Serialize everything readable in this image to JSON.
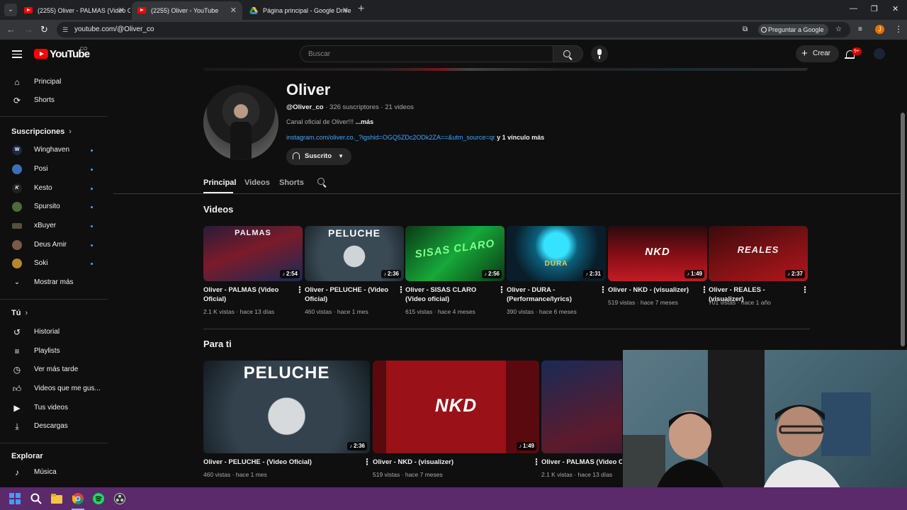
{
  "browser": {
    "tabs": [
      {
        "label": "(2255) Oliver - PALMAS (Video Ofi"
      },
      {
        "label": "(2255) Oliver - YouTube"
      },
      {
        "label": "Página principal - Google Drive"
      }
    ],
    "url": "youtube.com/@Oliver_co",
    "ask_google": "Preguntar a Google",
    "profile_initial": "J"
  },
  "header": {
    "logo_text": "YouTube",
    "country": "CO",
    "search_placeholder": "Buscar",
    "create_label": "Crear",
    "notif_count": "9+"
  },
  "sidebar": {
    "main": [
      {
        "label": "Principal",
        "icon": "home-icon"
      },
      {
        "label": "Shorts",
        "icon": "shorts-icon"
      }
    ],
    "subs_heading": "Suscripciones",
    "subs": [
      {
        "label": "Winghaven",
        "abbr": "W",
        "color": "#1e2a44"
      },
      {
        "label": "Posi",
        "abbr": "",
        "color": "#3d6fb6"
      },
      {
        "label": "Kesto",
        "abbr": "K",
        "color": "#222222"
      },
      {
        "label": "Spursito",
        "abbr": "",
        "color": "#4d6b3a"
      },
      {
        "label": "xBuyer",
        "abbr": "",
        "color": "#55503a"
      },
      {
        "label": "Deus Amir",
        "abbr": "",
        "color": "#7a5a48"
      },
      {
        "label": "Soki",
        "abbr": "",
        "color": "#b7862d"
      }
    ],
    "show_more": "Mostrar más",
    "you_heading": "Tú",
    "you": [
      {
        "label": "Historial",
        "icon": "history-icon"
      },
      {
        "label": "Playlists",
        "icon": "playlists-icon"
      },
      {
        "label": "Ver más tarde",
        "icon": "watch-later-icon"
      },
      {
        "label": "Videos que me gus...",
        "icon": "liked-videos-icon"
      },
      {
        "label": "Tus videos",
        "icon": "your-videos-icon"
      },
      {
        "label": "Descargas",
        "icon": "downloads-icon"
      }
    ],
    "explore_heading": "Explorar",
    "explore": [
      {
        "label": "Música",
        "icon": "music-icon"
      }
    ]
  },
  "channel": {
    "name": "Oliver",
    "handle": "@Oliver_co",
    "subscribers": "326 suscriptores",
    "videos_count": "21 videos",
    "description": "Canal oficial de Oliver!!!",
    "more": "...más",
    "link": "instagram.com/oliver.co._?igshid=OGQ5ZDc2ODk2ZA==&utm_source=qr",
    "more_links": "y 1 vínculo más",
    "subscribe_label": "Suscrito",
    "tabs": [
      "Principal",
      "Videos",
      "Shorts"
    ]
  },
  "videos_section": {
    "title": "Videos",
    "items": [
      {
        "title": "Oliver - PALMAS (Video Oficial)",
        "views": "2.1 K vistas",
        "age": "hace 13 días",
        "duration": "2:54",
        "thumb_text": "PALMAS",
        "thumb_color": "#7b1b2a"
      },
      {
        "title": "Oliver - PELUCHE - (Video Oficial)",
        "views": "460 vistas",
        "age": "hace 1 mes",
        "duration": "2:36",
        "thumb_text": "PELUCHE",
        "thumb_color": "#3a4a55"
      },
      {
        "title": "Oliver - SISAS CLARO (Video oficial)",
        "views": "615 vistas",
        "age": "hace 4 meses",
        "duration": "2:56",
        "thumb_text": "SISAS CLARO",
        "thumb_color": "#0f5a1e"
      },
      {
        "title": "Oliver - DURA - (Performance/lyrics)",
        "views": "390 vistas",
        "age": "hace 6 meses",
        "duration": "2:31",
        "thumb_text": "DURA",
        "thumb_color": "#0b5f7a"
      },
      {
        "title": "Oliver - NKD - (visualizer)",
        "views": "519 vistas",
        "age": "hace 7 meses",
        "duration": "1:49",
        "thumb_text": "NKD",
        "thumb_color": "#8a0f16"
      },
      {
        "title": "Oliver - REALES - (visualizer)",
        "views": "701 vistas",
        "age": "hace 1 año",
        "duration": "2:37",
        "thumb_text": "REALES",
        "thumb_color": "#7a1114"
      }
    ]
  },
  "foryou_section": {
    "title": "Para ti",
    "items": [
      {
        "title": "Oliver - PELUCHE - (Video Oficial)",
        "views": "460 vistas",
        "age": "hace 1 mes",
        "duration": "2:36",
        "thumb_text": "PELUCHE",
        "thumb_color": "#33424d"
      },
      {
        "title": "Oliver - NKD - (visualizer)",
        "views": "519 vistas",
        "age": "hace 7 meses",
        "duration": "1:49",
        "thumb_text": "NKD",
        "thumb_color": "#9a1118"
      },
      {
        "title": "Oliver - PALMAS (Video Ofi",
        "views": "2.1 K vistas",
        "age": "hace 13 días",
        "duration": "",
        "thumb_text": "PA",
        "thumb_color": "#5d1a2c"
      }
    ]
  }
}
